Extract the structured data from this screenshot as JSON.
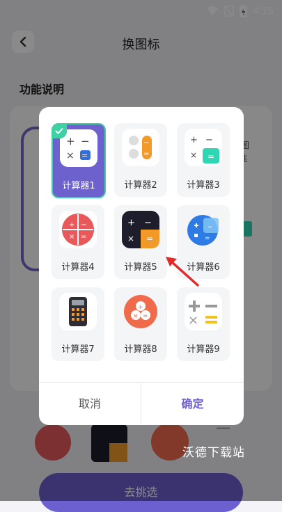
{
  "status_bar": {
    "time": "4:15"
  },
  "page": {
    "title": "换图标",
    "section_title": "功能说明",
    "side_text_line1": "图",
    "side_text_line2": "挑",
    "bottom_button": "去挑选"
  },
  "dialog": {
    "icons": [
      {
        "label": "计算器1",
        "selected": true
      },
      {
        "label": "计算器2",
        "selected": false
      },
      {
        "label": "计算器3",
        "selected": false
      },
      {
        "label": "计算器4",
        "selected": false
      },
      {
        "label": "计算器5",
        "selected": false
      },
      {
        "label": "计算器6",
        "selected": false
      },
      {
        "label": "计算器7",
        "selected": false
      },
      {
        "label": "计算器8",
        "selected": false
      },
      {
        "label": "计算器9",
        "selected": false
      }
    ],
    "cancel_label": "取消",
    "confirm_label": "确定"
  },
  "watermark": "沃德下载站",
  "colors": {
    "accent": "#6c5fd0",
    "selected_border": "#3fd0a4",
    "arrow": "#e02b2b"
  }
}
